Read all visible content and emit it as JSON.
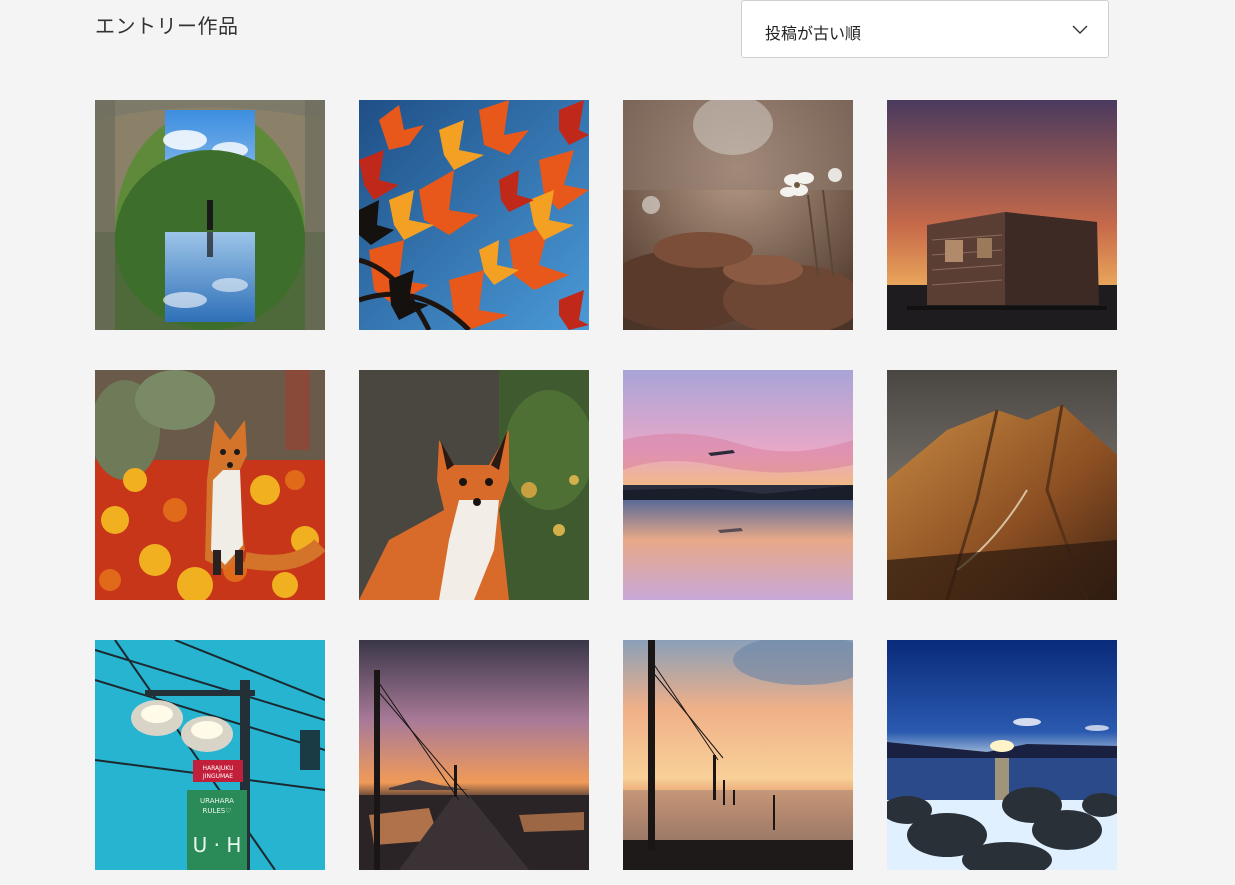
{
  "header": {
    "title": "エントリー作品"
  },
  "sort": {
    "selected": "投稿が古い順"
  },
  "entries": [
    {
      "subject": "tunnel-reflection"
    },
    {
      "subject": "autumn-maple-leaves"
    },
    {
      "subject": "small-white-flower"
    },
    {
      "subject": "abandoned-trailer-sunset"
    },
    {
      "subject": "fox-in-autumn-leaves"
    },
    {
      "subject": "fox-portrait"
    },
    {
      "subject": "airplane-sunset-reflection"
    },
    {
      "subject": "golden-mountain-ridge"
    },
    {
      "subject": "street-lamp-signs",
      "sign_texts": [
        "HARAJUKU JINGUMAE",
        "URAHARA RULES",
        "U H"
      ]
    },
    {
      "subject": "pole-path-sunset"
    },
    {
      "subject": "poles-in-sea-sunset"
    },
    {
      "subject": "rocky-shore-sunrise"
    }
  ]
}
